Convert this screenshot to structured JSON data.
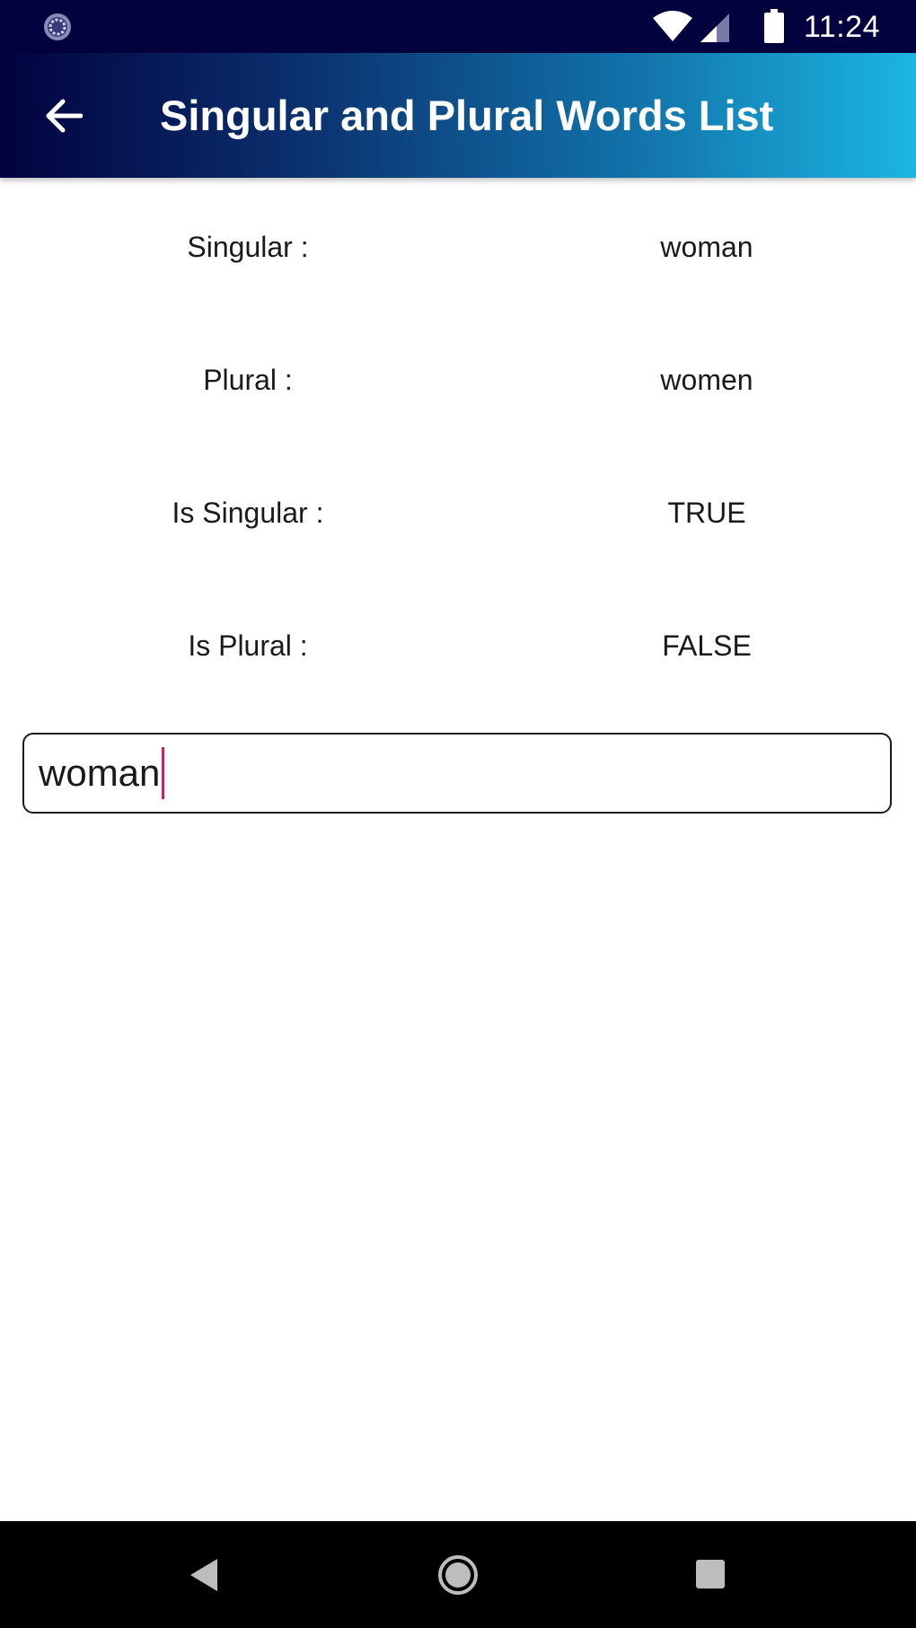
{
  "status_bar": {
    "time": "11:24",
    "icons": [
      "sync-status-icon",
      "wifi-icon",
      "cell-signal-icon",
      "battery-icon"
    ]
  },
  "app_bar": {
    "title": "Singular and Plural Words List",
    "back_icon": "arrow-left-icon"
  },
  "rows": [
    {
      "label": "Singular :",
      "value": "woman"
    },
    {
      "label": "Plural :",
      "value": "women"
    },
    {
      "label": "Is Singular :",
      "value": "TRUE"
    },
    {
      "label": "Is Plural :",
      "value": "FALSE"
    }
  ],
  "input": {
    "value": "woman"
  },
  "colors": {
    "status_bar": "#02023f",
    "app_bar_start": "#02023f",
    "app_bar_end": "#1bb6e2",
    "caret": "#d81b60",
    "nav_bar": "#000000"
  },
  "nav_bar": {
    "icons": [
      "nav-back-icon",
      "nav-home-icon",
      "nav-recents-icon"
    ]
  }
}
